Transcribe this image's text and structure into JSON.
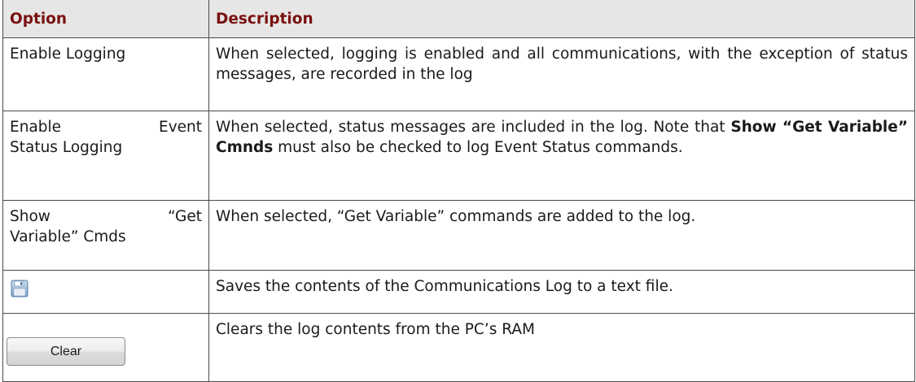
{
  "header": {
    "option": "Option",
    "description": "Description"
  },
  "rows": [
    {
      "option_line1_left": "Enable Logging",
      "description": "When selected, logging is enabled and all communications, with the exception of status messages, are recorded in the log"
    },
    {
      "option_line1_left": "Enable",
      "option_line1_right": "Event",
      "option_line2": "Status Logging",
      "description_part1": "When selected, status messages are included in the log. Note that ",
      "description_bold": "Show “Get Variable” Cmnds",
      "description_part2": " must also be checked to log Event Status commands."
    },
    {
      "option_line1_left": "Show",
      "option_line1_right": "“Get",
      "option_line2": "Variable” Cmds",
      "description": "When selected, “Get Variable” commands are added to the log."
    },
    {
      "icon": "save-floppy-icon",
      "description": "Saves the contents of the Communications Log to a text file."
    },
    {
      "button_label": "Clear",
      "description": "Clears the log contents from the PC’s RAM"
    }
  ]
}
